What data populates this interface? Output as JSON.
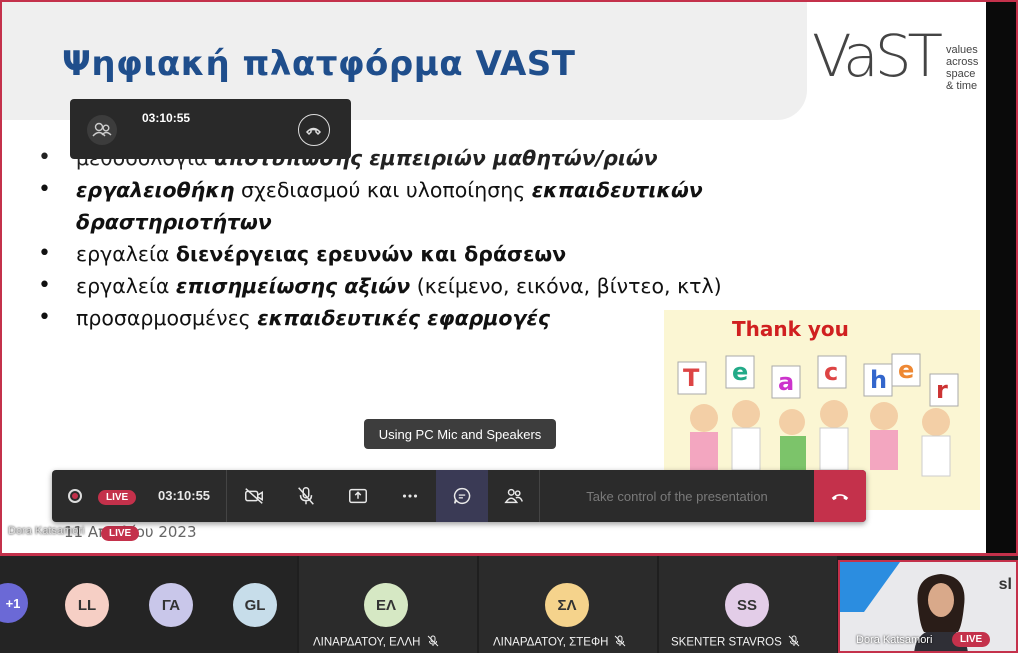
{
  "slide": {
    "title": "Ψηφιακή πλατφόρμα VAST",
    "logo": {
      "wordmark": "VaST",
      "tagline": [
        "values",
        "across",
        "space",
        "& time"
      ]
    },
    "bullets": [
      [
        {
          "t": "μεθοδολογία ",
          "s": "n"
        },
        {
          "t": "αποτύπωσης εμπειριών μαθητών/ριών",
          "s": "bi"
        }
      ],
      [
        {
          "t": "εργαλειοθήκη",
          "s": "bi"
        },
        {
          "t": " σχεδιασμού και υλοποίησης ",
          "s": "n"
        },
        {
          "t": "εκπαιδευτικών δραστηριοτήτων",
          "s": "bi"
        }
      ],
      [
        {
          "t": "εργαλεία ",
          "s": "n"
        },
        {
          "t": "διενέργειας ερευνών και δράσεων",
          "s": "b"
        }
      ],
      [
        {
          "t": "εργαλεία ",
          "s": "n"
        },
        {
          "t": "επισημείωσης αξιών",
          "s": "bi"
        },
        {
          "t": " (κείμενο, εικόνα, βίντεο, κτλ)",
          "s": "n"
        }
      ],
      [
        {
          "t": "προσαρμοσμένες ",
          "s": "n"
        },
        {
          "t": "εκπαιδευτικές εφαρμογές",
          "s": "bi"
        }
      ]
    ],
    "date": "11 Απριλίου 2023",
    "image_caption": "Thank you Teacher"
  },
  "presenter": {
    "name": "Dora Katsamori",
    "live": "LIVE"
  },
  "tiny_window": {
    "timer": "03:10:55"
  },
  "tooltip": "Using PC Mic and Speakers",
  "toolbar": {
    "live": "LIVE",
    "timer": "03:10:55",
    "take_control": "Take control of the presentation"
  },
  "participants": {
    "overflow": "+1",
    "tiles": [
      {
        "initials": "LL",
        "color": "#f6cfc5"
      },
      {
        "initials": "ΓΑ",
        "color": "#c9c7ea"
      },
      {
        "initials": "GL",
        "color": "#c7ddea"
      },
      {
        "initials": "ΕΛ",
        "color": "#d6e8c4",
        "name": "ΛΙΝΑΡΔΑΤΟΥ, ΕΛΛΗ"
      },
      {
        "initials": "ΣΛ",
        "color": "#f5d38c",
        "name": "ΛΙΝΑΡΔΑΤΟΥ, ΣΤΕΦΗ"
      },
      {
        "initials": "SS",
        "color": "#e3cde8",
        "name": "SKENTER STAVROS"
      }
    ],
    "video": {
      "name": "Dora Katsamori",
      "live": "LIVE",
      "brand": "sl"
    }
  },
  "colors": {
    "accent_red": "#c4314b",
    "title_blue": "#1f4e8c",
    "toolbar_bg": "#2b2b2b"
  }
}
